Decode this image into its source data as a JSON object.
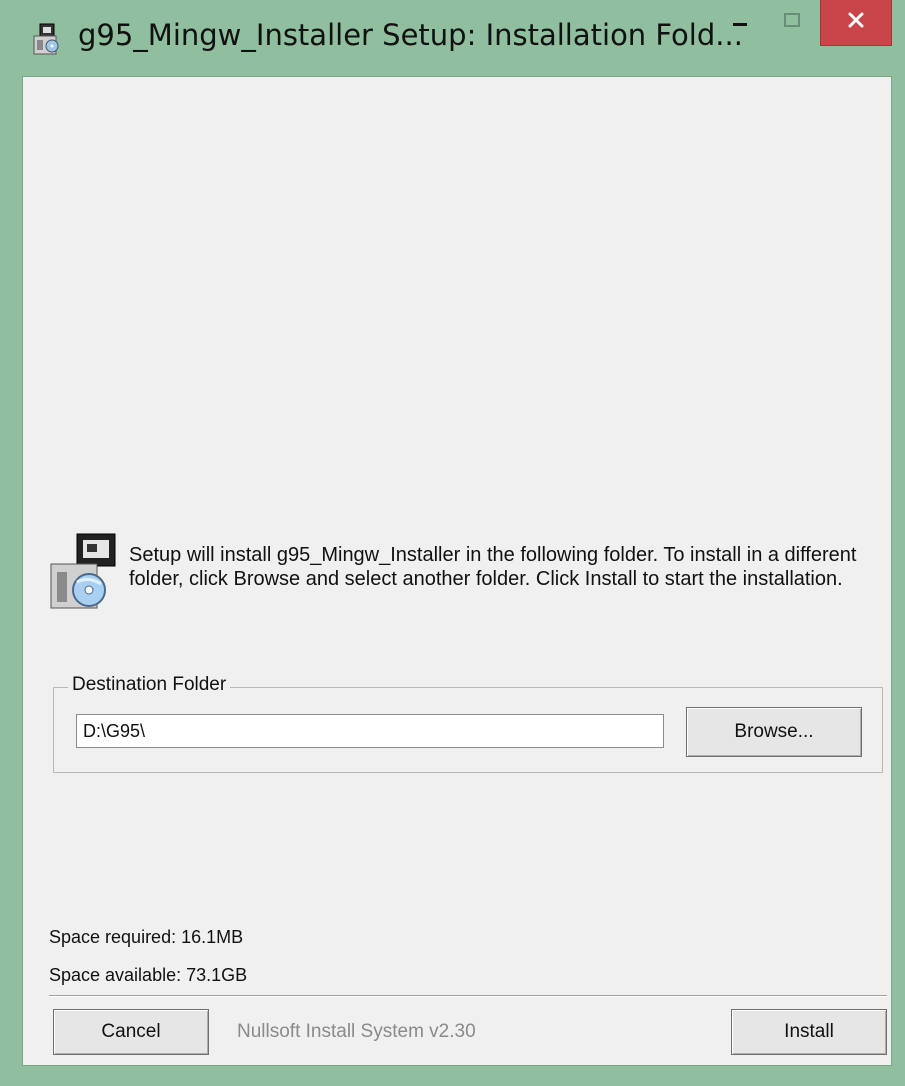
{
  "window": {
    "title": "g95_Mingw_Installer Setup: Installation Fold...",
    "icons": {
      "app": "installer-icon",
      "minimize": "minimize-icon",
      "maximize": "maximize-icon",
      "close": "close-icon"
    },
    "colors": {
      "frame": "#8fbf9f",
      "close_button": "#c9454a",
      "client": "#f0f0f0"
    }
  },
  "info": {
    "icon": "setup-disk-icon",
    "text": "Setup will install g95_Mingw_Installer in the following folder. To install in a different folder, click Browse and select another folder. Click Install to start the installation."
  },
  "destination": {
    "group_label": "Destination Folder",
    "path": "D:\\G95\\",
    "browse_label": "Browse..."
  },
  "space": {
    "required": "Space required: 16.1MB",
    "available": "Space available: 73.1GB"
  },
  "footer": {
    "cancel_label": "Cancel",
    "brand": "Nullsoft Install System v2.30",
    "install_label": "Install"
  }
}
